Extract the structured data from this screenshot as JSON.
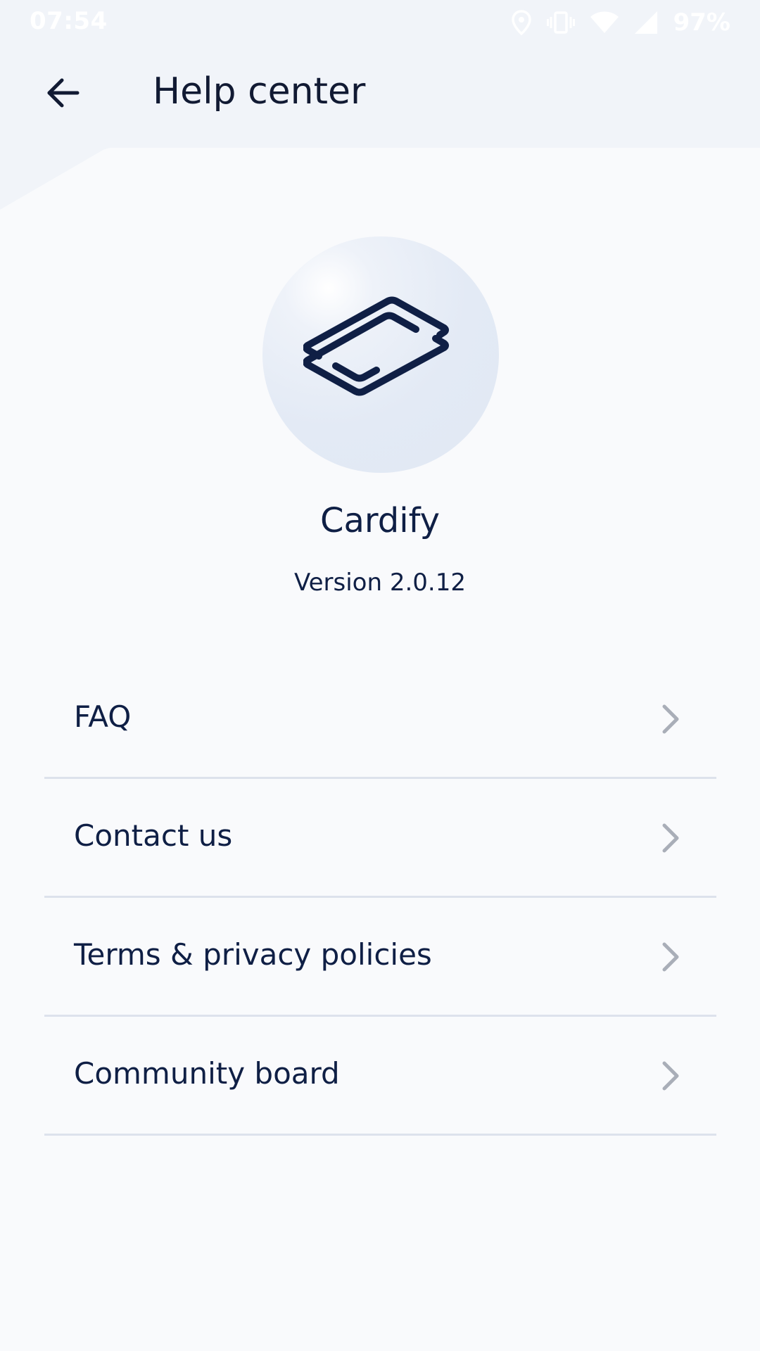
{
  "status_bar": {
    "time": "07:54",
    "battery": "97%",
    "icons": [
      "location-icon",
      "vibrate-icon",
      "wifi-icon",
      "signal-icon"
    ]
  },
  "app_bar": {
    "title": "Help center",
    "back_icon": "arrow-left-icon"
  },
  "app_info": {
    "name": "Cardify",
    "version": "Version 2.0.12",
    "logo_icon": "cardify-logo-icon"
  },
  "menu": {
    "items": [
      {
        "label": "FAQ",
        "icon": "chevron-right-icon"
      },
      {
        "label": "Contact us",
        "icon": "chevron-right-icon"
      },
      {
        "label": "Terms & privacy policies",
        "icon": "chevron-right-icon"
      },
      {
        "label": "Community board",
        "icon": "chevron-right-icon"
      }
    ]
  },
  "colors": {
    "background": "#f9fafc",
    "header_background": "#f1f4f9",
    "text_primary": "#0f1f45",
    "divider": "#dde2ec",
    "chevron": "#a9aeb8"
  }
}
